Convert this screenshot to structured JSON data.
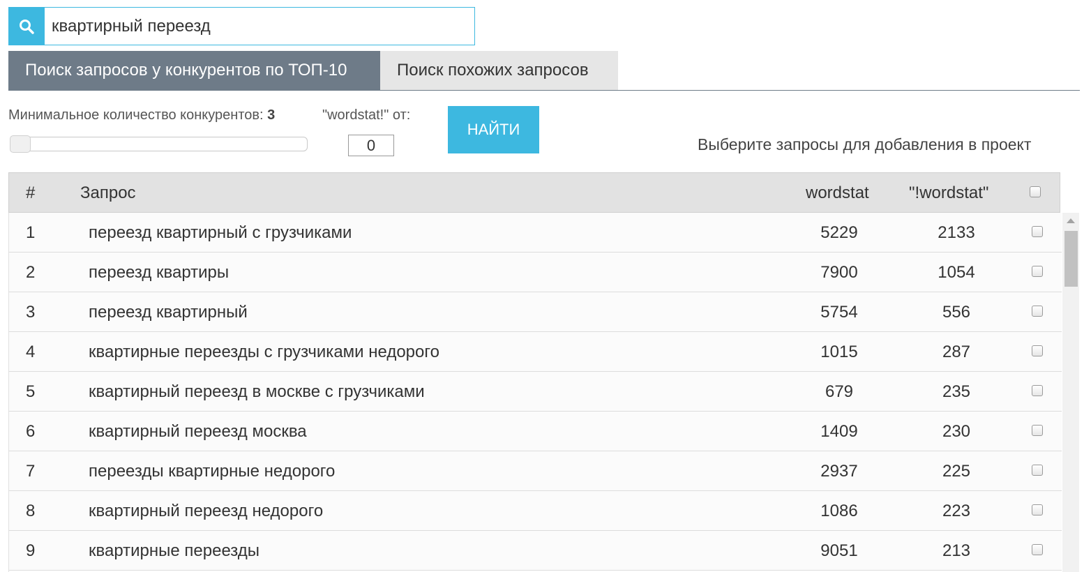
{
  "search": {
    "icon": "search-icon",
    "value": "квартирный переезд"
  },
  "tabs": [
    {
      "label": "Поиск запросов у конкурентов по ТОП-10",
      "active": true
    },
    {
      "label": "Поиск похожих запросов",
      "active": false
    }
  ],
  "filters": {
    "min_competitors_label": "Минимальное количество конкурентов:",
    "min_competitors_value": "3",
    "wordstat_from_label": "\"wordstat!\" от:",
    "wordstat_from_value": "0",
    "find_button": "НАЙТИ",
    "hint": "Выберите запросы для добавления в проект"
  },
  "table": {
    "columns": [
      "#",
      "Запрос",
      "wordstat",
      "\"!wordstat\""
    ],
    "rows": [
      {
        "num": "1",
        "query": "переезд квартирный с грузчиками",
        "wordstat": "5229",
        "exact_wordstat": "2133"
      },
      {
        "num": "2",
        "query": "переезд квартиры",
        "wordstat": "7900",
        "exact_wordstat": "1054"
      },
      {
        "num": "3",
        "query": "переезд квартирный",
        "wordstat": "5754",
        "exact_wordstat": "556"
      },
      {
        "num": "4",
        "query": "квартирные переезды с грузчиками недорого",
        "wordstat": "1015",
        "exact_wordstat": "287"
      },
      {
        "num": "5",
        "query": "квартирный переезд в москве с грузчиками",
        "wordstat": "679",
        "exact_wordstat": "235"
      },
      {
        "num": "6",
        "query": "квартирный переезд москва",
        "wordstat": "1409",
        "exact_wordstat": "230"
      },
      {
        "num": "7",
        "query": "переезды квартирные недорого",
        "wordstat": "2937",
        "exact_wordstat": "225"
      },
      {
        "num": "8",
        "query": "квартирный переезд недорого",
        "wordstat": "1086",
        "exact_wordstat": "223"
      },
      {
        "num": "9",
        "query": "квартирные переезды",
        "wordstat": "9051",
        "exact_wordstat": "213"
      }
    ]
  },
  "colors": {
    "accent": "#3db8e0",
    "tab_active": "#6e7b88",
    "tab_inactive": "#e6e6e6",
    "header_bg": "#e2e2e2"
  }
}
